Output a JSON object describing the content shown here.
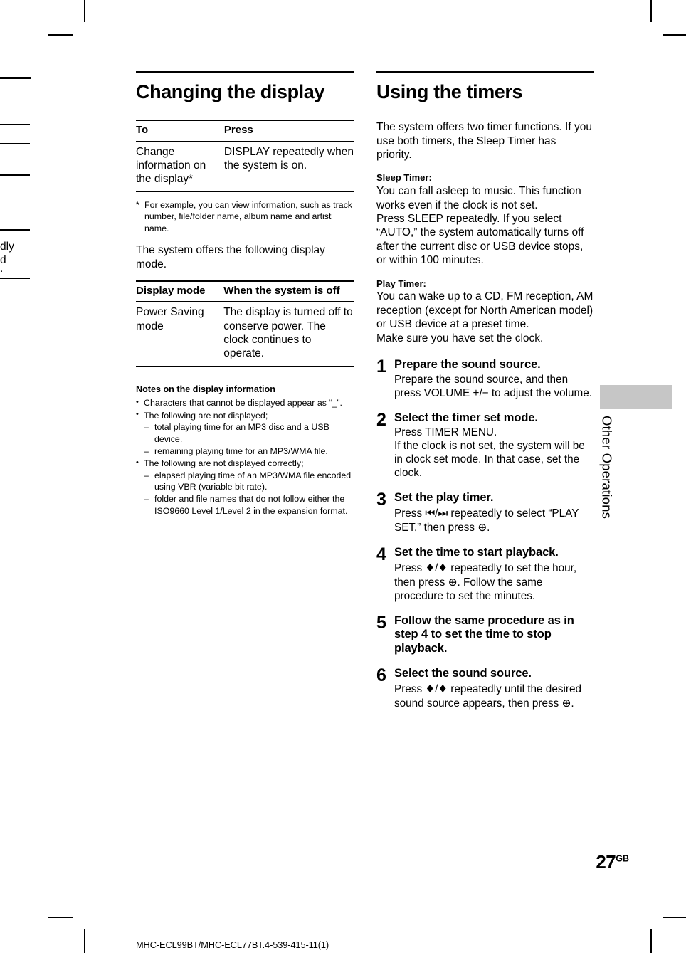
{
  "page": {
    "number": "27",
    "number_suffix": "GB",
    "footer_code": "MHC-ECL99BT/MHC-ECL77BT.4-539-415-11(1)",
    "side_tab_label": "Other Operations",
    "side_tab_color": "#c6c6c6"
  },
  "bleed": {
    "line1": "dly",
    "line2": "d",
    "line3": "."
  },
  "left_column": {
    "title": "Changing the display",
    "table1": {
      "headers": [
        "To",
        "Press"
      ],
      "rows": [
        [
          "Change information on the display*",
          "DISPLAY repeatedly when the system is on."
        ]
      ]
    },
    "footnote": {
      "mark": "*",
      "text": "For example, you can view information, such as track number, file/folder name, album name and artist name."
    },
    "intro": "The system offers the following display mode.",
    "table2": {
      "headers": [
        "Display mode",
        "When the system is off"
      ],
      "rows": [
        [
          "Power Saving mode",
          "The display is turned off to conserve power. The clock continues to operate."
        ]
      ]
    },
    "notes": {
      "heading": "Notes on the display information",
      "items": [
        {
          "bullet": "•",
          "text": "Characters that cannot be displayed appear as “_”.",
          "sub": []
        },
        {
          "bullet": "•",
          "text": "The following are not displayed;",
          "sub": [
            "total playing time for an MP3 disc and a USB device.",
            "remaining playing time for an MP3/WMA file."
          ]
        },
        {
          "bullet": "•",
          "text": "The following are not displayed correctly;",
          "sub": [
            "elapsed playing time of an MP3/WMA file encoded using VBR (variable bit rate).",
            "folder and file names that do not follow either the ISO9660 Level 1/Level 2 in the expansion format."
          ]
        }
      ]
    }
  },
  "right_column": {
    "title": "Using the timers",
    "intro": "The system offers two timer functions. If you use both timers, the Sleep Timer has priority.",
    "sleep_timer": {
      "heading": "Sleep Timer:",
      "text": "You can fall asleep to music. This function works even if the clock is not set.\nPress SLEEP repeatedly. If you select “AUTO,” the system automatically turns off after the current disc or USB device stops, or within 100 minutes."
    },
    "play_timer": {
      "heading": "Play Timer:",
      "text": "You can wake up to a CD, FM reception, AM reception (except for North American model) or USB device at a preset time.\nMake sure you have set the clock."
    },
    "steps": [
      {
        "num": "1",
        "headline": "Prepare the sound source.",
        "detail_parts": [
          {
            "type": "text",
            "value": "Prepare the sound source, and then press VOLUME +/− to adjust the volume."
          }
        ]
      },
      {
        "num": "2",
        "headline": "Select the timer set mode.",
        "detail_parts": [
          {
            "type": "text",
            "value": "Press TIMER MENU.\nIf the clock is not set, the system will be in clock set mode. In that case, set the clock."
          }
        ]
      },
      {
        "num": "3",
        "headline": "Set the play timer.",
        "detail_parts": [
          {
            "type": "text",
            "value": "Press "
          },
          {
            "type": "glyph",
            "value": "prev-track-icon"
          },
          {
            "type": "text",
            "value": "/"
          },
          {
            "type": "glyph",
            "value": "next-track-icon"
          },
          {
            "type": "text",
            "value": " repeatedly to select “PLAY SET,” then press "
          },
          {
            "type": "glyph",
            "value": "enter-icon"
          },
          {
            "type": "text",
            "value": "."
          }
        ]
      },
      {
        "num": "4",
        "headline": "Set the time to start playback.",
        "detail_parts": [
          {
            "type": "text",
            "value": "Press "
          },
          {
            "type": "glyph",
            "value": "up-arrow-icon"
          },
          {
            "type": "text",
            "value": "/"
          },
          {
            "type": "glyph",
            "value": "down-arrow-icon"
          },
          {
            "type": "text",
            "value": " repeatedly to set the hour, then press "
          },
          {
            "type": "glyph",
            "value": "enter-icon"
          },
          {
            "type": "text",
            "value": ". Follow the same procedure to set the minutes."
          }
        ]
      },
      {
        "num": "5",
        "headline": "Follow the same procedure as in step 4 to set the time to stop playback.",
        "detail_parts": []
      },
      {
        "num": "6",
        "headline": "Select the sound source.",
        "detail_parts": [
          {
            "type": "text",
            "value": "Press "
          },
          {
            "type": "glyph",
            "value": "up-arrow-icon"
          },
          {
            "type": "text",
            "value": "/"
          },
          {
            "type": "glyph",
            "value": "down-arrow-icon"
          },
          {
            "type": "text",
            "value": " repeatedly until the desired sound source appears, then press "
          },
          {
            "type": "glyph",
            "value": "enter-icon"
          },
          {
            "type": "text",
            "value": "."
          }
        ]
      }
    ]
  }
}
